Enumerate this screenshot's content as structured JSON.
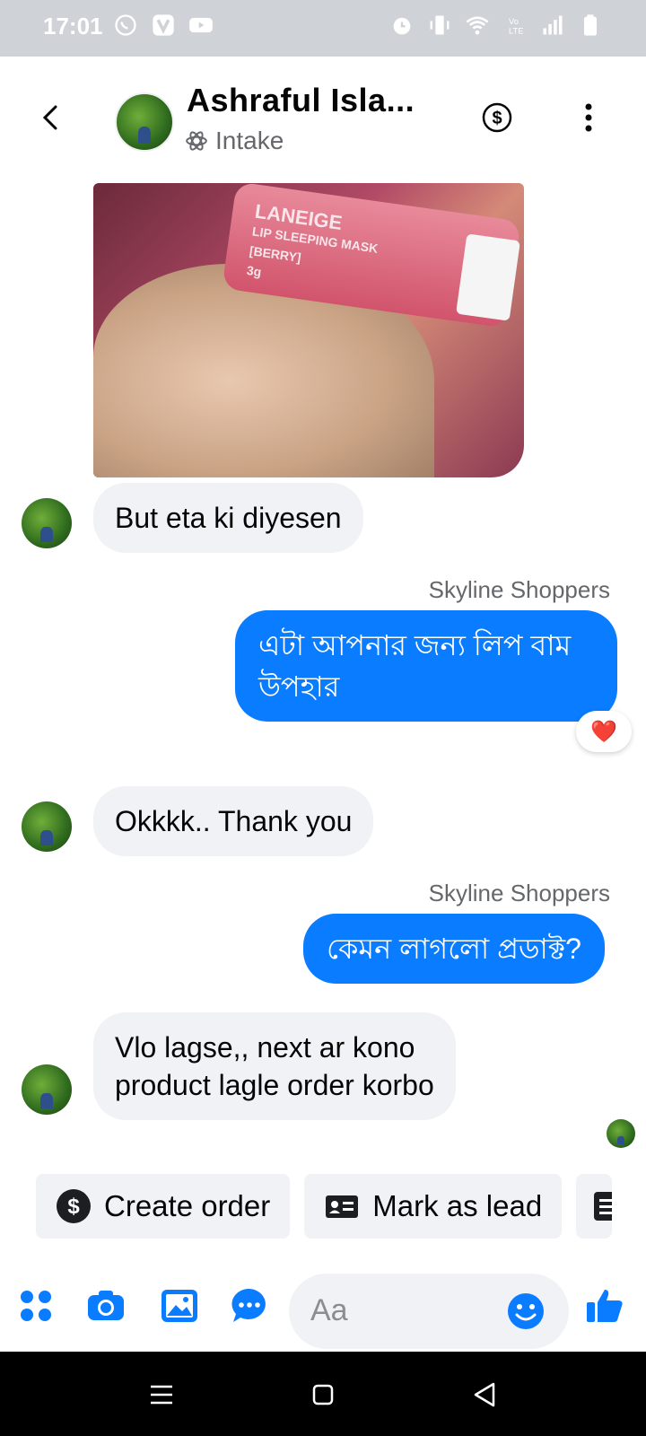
{
  "status_bar": {
    "time": "17:01"
  },
  "header": {
    "contact_name": "Ashraful Isla...",
    "label": "Intake"
  },
  "messages": [
    {
      "text": "But eta ki diyesen"
    },
    {
      "sender": "Skyline Shoppers",
      "text_line1": "এটা আপনার জন্য লিপ বাম",
      "text_line2": "উপহার",
      "reaction": "❤️"
    },
    {
      "text": "Okkkk.. Thank you"
    },
    {
      "sender": "Skyline Shoppers",
      "text": "কেমন লাগলো প্রডাক্ট?"
    },
    {
      "text_line1": "Vlo lagse,, next ar kono",
      "text_line2": "product lagle order korbo"
    }
  ],
  "photo": {
    "jar_text_line1": "LANEIGE",
    "jar_text_line2": "LIP SLEEPING MASK",
    "jar_text_line3": "[BERRY]",
    "jar_text_line4": "3g"
  },
  "actions": {
    "create_order": "Create order",
    "mark_as_lead": "Mark as lead"
  },
  "composer": {
    "placeholder": "Aa"
  },
  "colors": {
    "accent": "#0a7cff",
    "bubble_in": "#f0f2f5",
    "status_bar": "#cfd2d6"
  }
}
